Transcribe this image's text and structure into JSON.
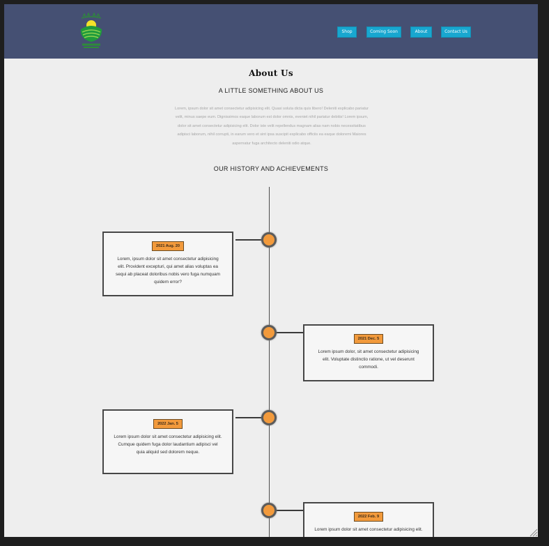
{
  "header": {
    "logo_alt": "logo",
    "nav": [
      "Shop",
      "Coming Soon",
      "About",
      "Contact Us"
    ]
  },
  "about": {
    "title": "About Us",
    "subtitle": "A LITTLE SOMETHING ABOUT US",
    "intro": "Lorem, ipsum dolor sit amet consectetur adipisicing elit. Quasi soluta dicta quis libero! Deleniti explicabo pariatur velit, minus saepe eum. Dignissimos eaque laborum est dolor omnis, eveniet nihil pariatur debitis! Lorem ipsum, dolor sit amet consectetur adipisicing elit. Dolor iste velit repellendus magnam alias nam nobis necessitatibus adipisci laborum, nihil corrupti, in earum vero et sint ipsa suscipit explicabo officiis ea eaque doloremi Maiores aspernatur fuga architecto deleniti odio atque.",
    "history_heading": "OUR HISTORY AND ACHIEVEMENTS"
  },
  "timeline": [
    {
      "date": "2021 Aug. 20",
      "text": "Lorem, ipsum dolor sit amet consectetur adipisicing elit. Provident excepturi, qui amet alias voluptas ea sequi ab placeat doloribus nobis vero fuga numquam quidem error?"
    },
    {
      "date": "2021 Dec. 5",
      "text": "Lorem ipsum dolor, sit amet consectetur adipisicing elit. Voluptate distinctio ratione, ut vel deserunt commodi."
    },
    {
      "date": "2022 Jan. 5",
      "text": "Lorem ipsum dolor sit amet consectetur adipisicing elit. Cumque quidem fuga dolor laudantium adipisci vel quia aliquid sed dolorem neque."
    },
    {
      "date": "2022 Feb. 9",
      "text": "Lorem ipsum dolor sit amet consectetur adipisicing elit."
    }
  ],
  "colors": {
    "header": "#455073",
    "nav_button": "#18a7d0",
    "accent": "#f29a3c",
    "page_bg": "#eeeeee"
  }
}
